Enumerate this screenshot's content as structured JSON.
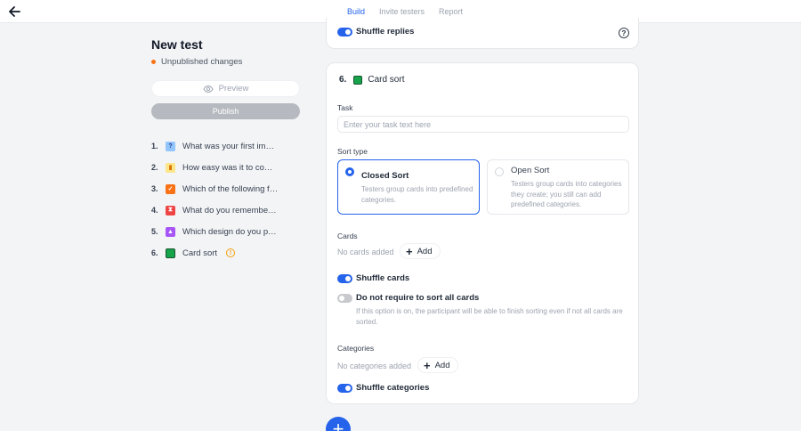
{
  "header": {
    "tabs": [
      {
        "label": "Build"
      },
      {
        "label": "Invite testers"
      },
      {
        "label": "Report"
      }
    ]
  },
  "sidebar": {
    "title": "New test",
    "status": "Unpublished changes",
    "preview_label": "Preview",
    "publish_label": "Publish",
    "questions": [
      {
        "num": "1.",
        "icon": "question-icon",
        "color": "#93c5fd",
        "glyph": "?",
        "text": "What was your first impression?"
      },
      {
        "num": "2.",
        "icon": "bar-chart-icon",
        "color": "#fbbf24",
        "glyph": "▮",
        "text": "How easy was it to complete?"
      },
      {
        "num": "3.",
        "icon": "checkbox-icon",
        "color": "#f97316",
        "glyph": "✓",
        "text": "Which of the following features"
      },
      {
        "num": "4.",
        "icon": "hourglass-icon",
        "color": "#ef4444",
        "glyph": "⧗",
        "text": "What do you remember about"
      },
      {
        "num": "5.",
        "icon": "design-icon",
        "color": "#a855f7",
        "glyph": "▲",
        "text": "Which design do you prefer?"
      },
      {
        "num": "6.",
        "icon": "card-sort-icon",
        "color": "#16a34a",
        "glyph": "▪",
        "text": "Card sort"
      }
    ]
  },
  "prev_card": {
    "shuffle_replies_label": "Shuffle replies"
  },
  "question": {
    "number": "6.",
    "title": "Card sort",
    "task_label": "Task",
    "task_placeholder": "Enter your task text here",
    "sort_type_label": "Sort type",
    "closed_sort": {
      "title": "Closed Sort",
      "desc": "Testers group cards into predefined categories."
    },
    "open_sort": {
      "title": "Open Sort",
      "desc": "Testers group cards into categories they create; you still can add predefined categories."
    },
    "cards_label": "Cards",
    "no_cards": "No cards added",
    "add_label": "Add",
    "shuffle_cards_label": "Shuffle cards",
    "not_require_label": "Do not require to sort all cards",
    "not_require_desc": "If this option is on, the participant will be able to finish sorting even if not all cards are sorted.",
    "categories_label": "Categories",
    "no_categories": "No categories added",
    "add_cat_label": "Add",
    "shuffle_categories_label": "Shuffle categories"
  },
  "fab_label": "+"
}
